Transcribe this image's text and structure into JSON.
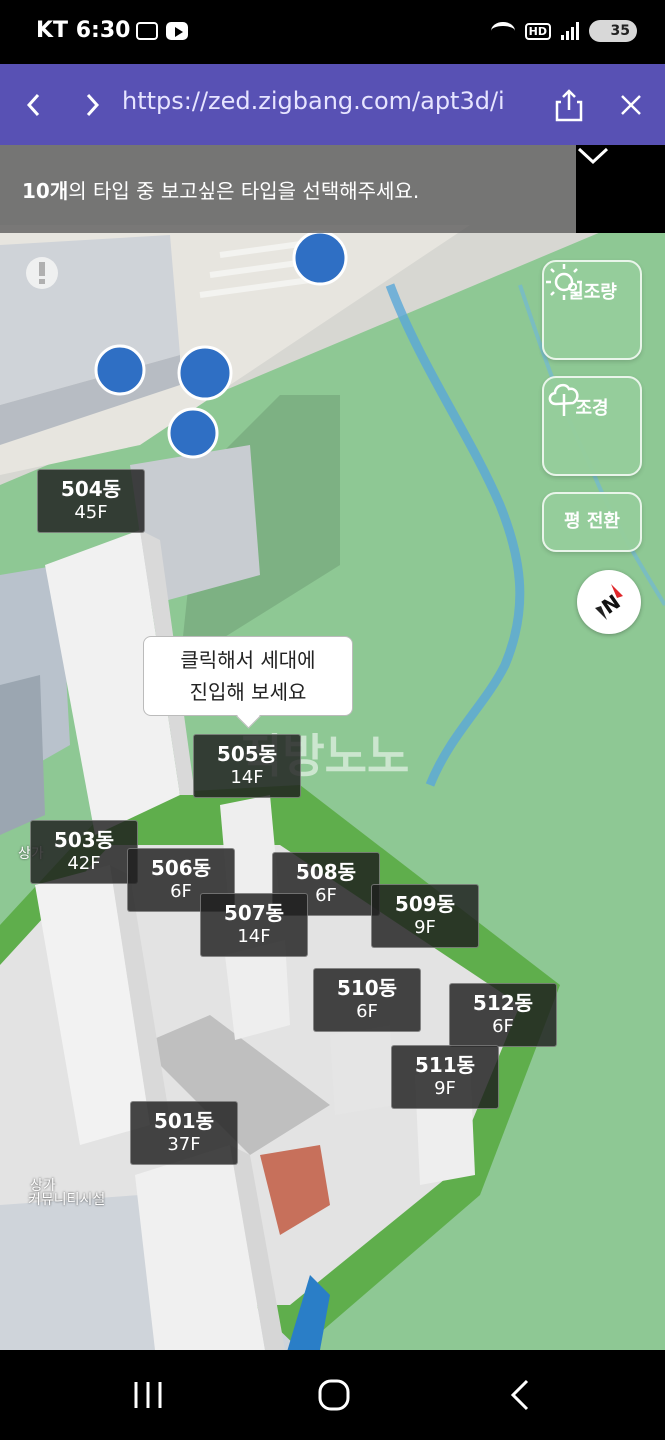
{
  "status_bar": {
    "carrier": "KT",
    "time": "6:30",
    "hd_badge": "HD",
    "battery": "35",
    "icons": [
      "screen-record-icon",
      "youtube-icon",
      "wifi-icon",
      "signal-icon",
      "battery-icon"
    ]
  },
  "browser": {
    "url": "https://zed.zigbang.com/apt3d/i",
    "icons": [
      "back-icon",
      "forward-icon",
      "share-icon",
      "close-icon"
    ]
  },
  "banner": {
    "count": "10개",
    "text": "의 타입 중 보고싶은 타입을 선택해주세요."
  },
  "side_buttons": {
    "sunlight_label": "일조량",
    "landscape_label": "조경",
    "pyeong_label": "평 전환"
  },
  "tooltip": {
    "line1": "클릭해서 세대에",
    "line2": "진입해 보세요"
  },
  "watermark": "직방노노",
  "map_labels": {
    "shop1": "상가",
    "shop2": "상가",
    "community": "커뮤니티시설"
  },
  "buildings": [
    {
      "dong": "504동",
      "floors": "45F"
    },
    {
      "dong": "505동",
      "floors": "14F"
    },
    {
      "dong": "503동",
      "floors": "42F"
    },
    {
      "dong": "506동",
      "floors": "6F"
    },
    {
      "dong": "508동",
      "floors": "6F"
    },
    {
      "dong": "507동",
      "floors": "14F"
    },
    {
      "dong": "509동",
      "floors": "9F"
    },
    {
      "dong": "510동",
      "floors": "6F"
    },
    {
      "dong": "512동",
      "floors": "6F"
    },
    {
      "dong": "511동",
      "floors": "9F"
    },
    {
      "dong": "501동",
      "floors": "37F"
    }
  ],
  "colors": {
    "browser_bar": "#5851b4",
    "map_green": "#8ec894",
    "river": "#5aa7d8",
    "bus_stop": "#2f6fc4"
  }
}
